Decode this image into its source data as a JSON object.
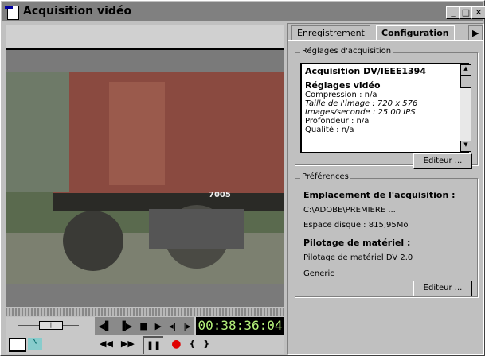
{
  "window": {
    "title": "Acquisition vidéo",
    "minimize": "_",
    "maximize": "□",
    "close": "✕"
  },
  "player": {
    "timecode": "00:38:36:04",
    "transport": [
      "◀▌",
      "▐▶",
      "■",
      "▶",
      "◂|",
      "|▸"
    ],
    "transport2": [
      "◀◀",
      "▶▶",
      "❚❚",
      "●",
      "{",
      "}"
    ]
  },
  "tabs": {
    "recording": "Enregistrement",
    "configuration": "Configuration",
    "more": "▶"
  },
  "capture_settings": {
    "legend": "Réglages d'acquisition",
    "header": "Acquisition DV/IEEE1394",
    "video_header": "Réglages vidéo",
    "compression": "Compression : n/a",
    "frame_size": "Taille de l'image : 720 x 576",
    "fps": "Images/seconde : 25.00 IPS",
    "depth": "Profondeur : n/a",
    "quality": "Qualité : n/a",
    "edit_button": "Editeur ..."
  },
  "preferences": {
    "legend": "Préférences",
    "location_header": "Emplacement de l'acquisition :",
    "path": "C:\\ADOBE\\PREMIERE ...",
    "disk_space": "Espace disque : 815,95Mo",
    "device_header": "Pilotage de matériel :",
    "device": "Pilotage de matériel DV 2.0",
    "device_model": "Generic",
    "edit_button": "Editeur ..."
  },
  "colors": {
    "timecode": "#b4f07a",
    "record": "#e00000"
  }
}
